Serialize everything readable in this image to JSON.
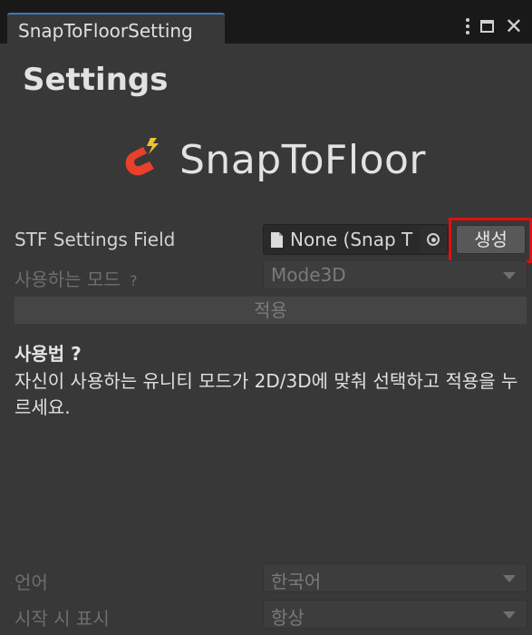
{
  "window": {
    "tab_title": "SnapToFloorSetting",
    "controls": [
      "kebab-menu-icon",
      "maximize-icon",
      "close-icon"
    ],
    "close_glyph": "✕"
  },
  "heading": "Settings",
  "logo": {
    "icon": "magnet-icon",
    "text": "SnapToFloor",
    "icon_color": "#e8402b",
    "spark_color": "#f2c12e"
  },
  "settings_field": {
    "label": "STF Settings Field",
    "value": "None (Snap T",
    "create_button": "생성",
    "highlight_color": "#e01010"
  },
  "mode": {
    "label": "사용하는 모드",
    "help": "?",
    "value": "Mode3D"
  },
  "apply_button": "적용",
  "usage": {
    "title": "사용법",
    "help": "?",
    "body": "자신이 사용하는 유니티 모드가 2D/3D에 맞춰 선택하고 적용을 누르세요."
  },
  "language": {
    "label": "언어",
    "value": "한국어"
  },
  "startup": {
    "label": "시작 시 표시",
    "value": "항상"
  }
}
